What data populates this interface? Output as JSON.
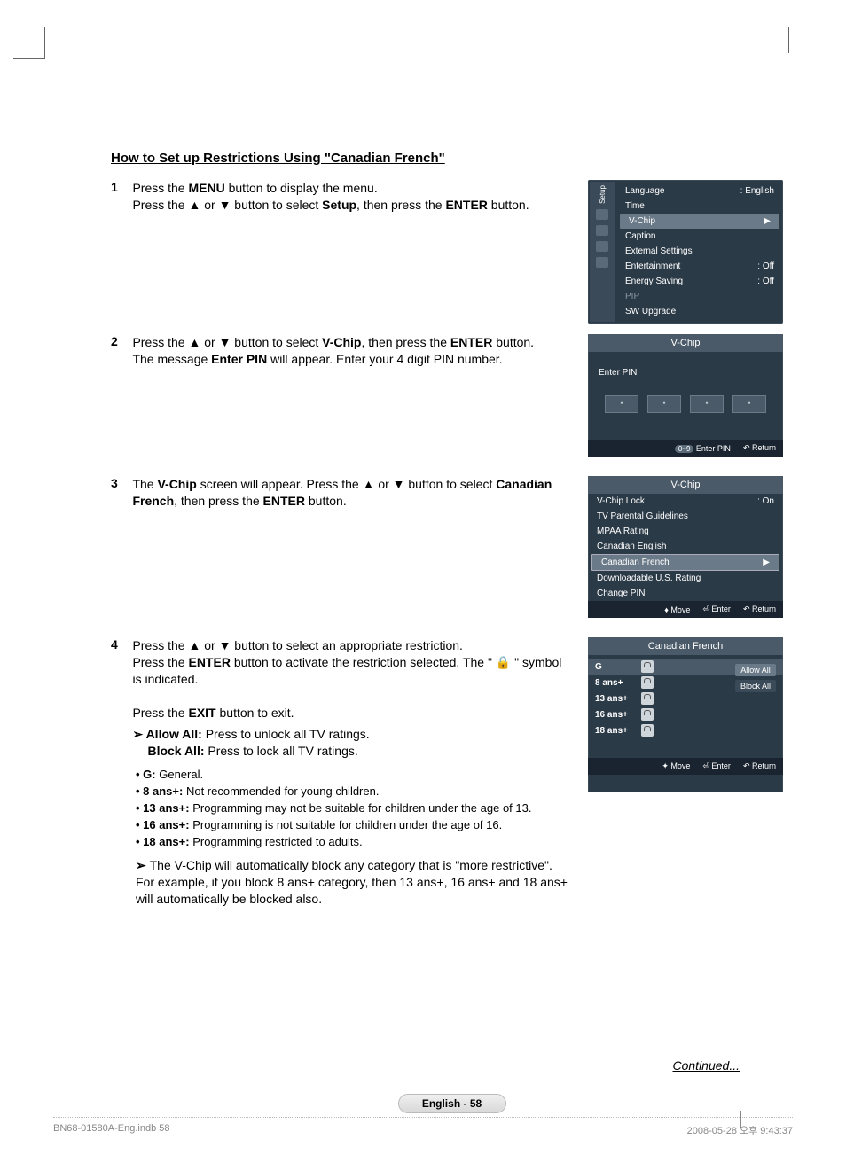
{
  "title": "How to Set up Restrictions Using \"Canadian French\"",
  "steps": {
    "s1": {
      "n": "1",
      "t1": "Press the ",
      "b1": "MENU",
      "t2": " button to display the menu.",
      "t3": "Press the ▲ or ▼ button to select ",
      "b2": "Setup",
      "t4": ", then press the ",
      "b3": "ENTER",
      "t5": " button."
    },
    "s2": {
      "n": "2",
      "t1": "Press the ▲ or ▼ button to select ",
      "b1": "V-Chip",
      "t2": ", then press the ",
      "b2": "ENTER",
      "t3": " button.",
      "t4": "The message ",
      "b3": "Enter PIN",
      "t5": " will appear. Enter your 4 digit PIN number."
    },
    "s3": {
      "n": "3",
      "t1": "The ",
      "b1": "V-Chip",
      "t2": " screen will appear. Press the ▲ or ▼ button to select ",
      "b2": "Canadian French",
      "t3": ", then press the ",
      "b3": "ENTER",
      "t4": " button."
    },
    "s4": {
      "n": "4",
      "t1": "Press the ▲ or ▼ button to select an appropriate restriction.",
      "t2": "Press the ",
      "b1": "ENTER",
      "t3": " button to activate the restriction selected. The \" 🔒 \" symbol is indicated.",
      "t4": "Press the ",
      "b2": "EXIT",
      "t5": " button to exit.",
      "aa": "Allow All:",
      "aat": " Press to unlock all TV ratings.",
      "ba": "Block All:",
      "bat": " Press to lock all TV ratings."
    }
  },
  "ratings": {
    "g": {
      "l": "G:",
      "t": " General."
    },
    "r8": {
      "l": "8 ans+:",
      "t": " Not recommended for young children."
    },
    "r13": {
      "l": "13 ans+:",
      "t": " Programming may not be suitable for children under the age of 13."
    },
    "r16": {
      "l": "16 ans+:",
      "t": " Programming is not suitable for children under the age of 16."
    },
    "r18": {
      "l": "18 ans+:",
      "t": " Programming restricted to adults."
    }
  },
  "note": "The V-Chip will automatically block any category that is \"more restrictive\". For example, if you block 8 ans+ category, then 13 ans+, 16 ans+ and 18 ans+ will automatically be blocked also.",
  "continued": "Continued...",
  "pagelabel": "English - 58",
  "footer": {
    "left": "BN68-01580A-Eng.indb   58",
    "right": "2008-05-28   오후 9:43:37"
  },
  "osd1": {
    "sidetab": "Setup",
    "items": [
      {
        "l": "Language",
        "v": ": English"
      },
      {
        "l": "Time",
        "v": ""
      },
      {
        "l": "V-Chip",
        "v": "",
        "sel": true,
        "arr": "▶"
      },
      {
        "l": "Caption",
        "v": ""
      },
      {
        "l": "External Settings",
        "v": ""
      },
      {
        "l": "Entertainment",
        "v": ": Off"
      },
      {
        "l": "Energy Saving",
        "v": ": Off"
      },
      {
        "l": "PIP",
        "v": "",
        "dis": true
      },
      {
        "l": "SW Upgrade",
        "v": ""
      }
    ]
  },
  "osd2": {
    "title": "V-Chip",
    "label": "Enter PIN",
    "pin": "*",
    "foot": {
      "a": "0~9",
      "at": "Enter PIN",
      "r": "Return"
    }
  },
  "osd3": {
    "title": "V-Chip",
    "items": [
      {
        "l": "V-Chip Lock",
        "v": ": On"
      },
      {
        "l": "TV Parental Guidelines"
      },
      {
        "l": "MPAA Rating"
      },
      {
        "l": "Canadian English"
      },
      {
        "l": "Canadian French",
        "sel": true,
        "arr": "▶"
      },
      {
        "l": "Downloadable U.S. Rating"
      },
      {
        "l": "Change PIN"
      }
    ],
    "foot": {
      "m": "Move",
      "e": "Enter",
      "r": "Return"
    }
  },
  "osd4": {
    "title": "Canadian French",
    "rows": [
      "G",
      "8 ans+",
      "13 ans+",
      "16 ans+",
      "18 ans+"
    ],
    "allow": "Allow All",
    "block": "Block All",
    "foot": {
      "m": "Move",
      "e": "Enter",
      "r": "Return"
    }
  }
}
